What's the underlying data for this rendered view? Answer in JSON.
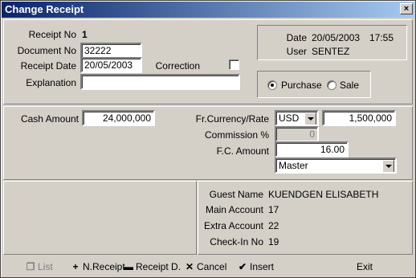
{
  "window": {
    "title": "Change Receipt",
    "close_glyph": "×"
  },
  "receipt": {
    "receipt_no_label": "Receipt No",
    "receipt_no": "1",
    "document_no_label": "Document No",
    "document_no": "32222",
    "receipt_date_label": "Receipt Date",
    "receipt_date": "20/05/2003",
    "correction_label": "Correction",
    "correction_checked": false,
    "explanation_label": "Explanation",
    "explanation": ""
  },
  "info": {
    "date_label": "Date",
    "date": "20/05/2003",
    "time": "17:55",
    "user_label": "User",
    "user": "SENTEZ"
  },
  "type": {
    "purchase_label": "Purchase",
    "sale_label": "Sale",
    "selected": "Purchase"
  },
  "amounts": {
    "cash_label": "Cash Amount",
    "cash": "24,000,000",
    "currency_label": "Fr.Currency/Rate",
    "currency": "USD",
    "rate": "1,500,000",
    "commission_label": "Commission %",
    "commission": "0",
    "fc_amount_label": "F.C. Amount",
    "fc_amount": "16.00",
    "card": "Master"
  },
  "guest": {
    "guest_name_label": "Guest Name",
    "guest_name": "KUENDGEN ELISABETH",
    "main_account_label": "Main Account",
    "main_account": "17",
    "extra_account_label": "Extra Account",
    "extra_account": "22",
    "checkin_label": "Check-In No",
    "checkin": "19"
  },
  "toolbar": {
    "list_label": "List",
    "new_receipt_label": "N.Receipt",
    "receipt_d_label": "Receipt D.",
    "cancel_label": "Cancel",
    "insert_label": "Insert",
    "exit_label": "Exit",
    "icons": {
      "list": "list-icon",
      "new": "plus-icon",
      "delete": "minus-icon",
      "cancel": "x-icon",
      "insert": "check-icon"
    }
  }
}
